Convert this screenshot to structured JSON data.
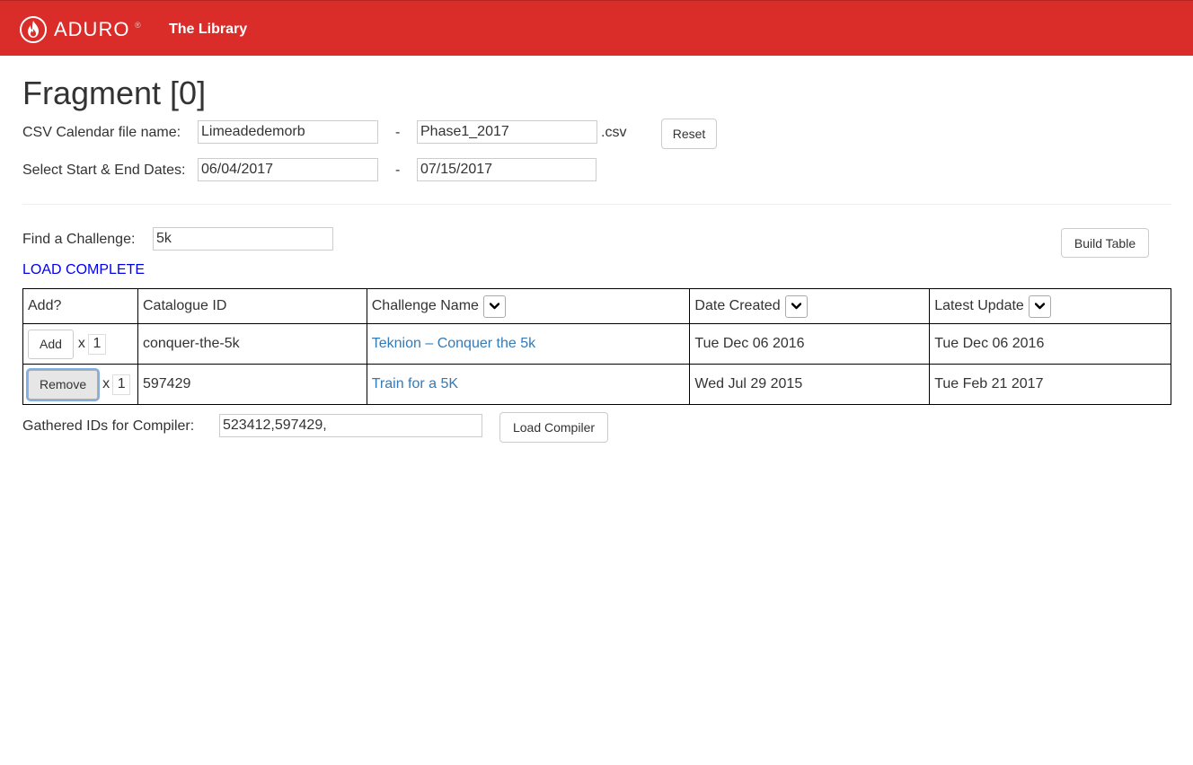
{
  "header": {
    "brand": "ADURO",
    "brand_mark": "®",
    "logo_icon": "flame-icon",
    "nav_title": "The Library",
    "bar_color": "#da2d2a"
  },
  "page": {
    "title": "Fragment [0]"
  },
  "csv": {
    "label": "CSV Calendar file name:",
    "prefix_value": "Limeadedemorb",
    "separator": "-",
    "suffix_value": "Phase1_2017",
    "extension": ".csv",
    "reset_label": "Reset"
  },
  "dates": {
    "label": "Select Start & End Dates:",
    "start": "06/04/2017",
    "separator": "-",
    "end": "07/15/2017"
  },
  "search": {
    "label": "Find a Challenge:",
    "value": "5k",
    "build_label": "Build Table",
    "status": "LOAD COMPLETE",
    "status_color": "#0000ee"
  },
  "table": {
    "columns": {
      "add": "Add?",
      "catalogue_id": "Catalogue ID",
      "challenge_name": "Challenge Name",
      "date_created": "Date Created",
      "latest_update": "Latest Update"
    },
    "rows": [
      {
        "button": "Add",
        "times": "x",
        "qty": "1",
        "catalogue_id": "conquer-the-5k",
        "name": "Teknion – Conquer the 5k",
        "created": "Tue Dec 06 2016",
        "updated": "Tue Dec 06 2016"
      },
      {
        "button": "Remove",
        "times": "x",
        "qty": "1",
        "catalogue_id": "597429",
        "name": "Train for a 5K",
        "created": "Wed Jul 29 2015",
        "updated": "Tue Feb 21 2017"
      }
    ],
    "link_color": "#337ab7"
  },
  "compiler": {
    "label": "Gathered IDs for Compiler:",
    "value": "523412,597429,",
    "button": "Load Compiler"
  }
}
